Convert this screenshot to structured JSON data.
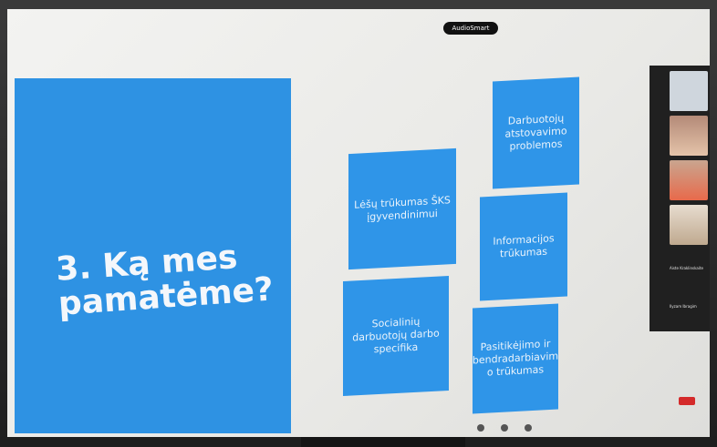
{
  "window": {
    "share_label": "AudioSmart"
  },
  "slide": {
    "title_line1": "3. Ką mes",
    "title_line2": "pamatėme?",
    "cards": [
      {
        "text": "Darbuotojų atstovavimo problemos"
      },
      {
        "text": "Lėšų trūkumas ŠKS įgyvendinimui"
      },
      {
        "text": "Informacijos trūkumas"
      },
      {
        "text": "Socialinių darbuotojų darbo specifika"
      },
      {
        "text": "Pasitikėjimo ir bendradarbiavim o trūkumas"
      }
    ]
  },
  "participants": {
    "tiles": [
      {
        "label": ""
      },
      {
        "label": ""
      },
      {
        "label": ""
      },
      {
        "label": ""
      }
    ],
    "names": [
      "Aiste Kraklinskaite",
      "Ilyzam Ibragim"
    ]
  },
  "colors": {
    "slide_blue": "#2e92e3",
    "card_blue": "#2f95e8",
    "end_red": "#d42a2a"
  }
}
